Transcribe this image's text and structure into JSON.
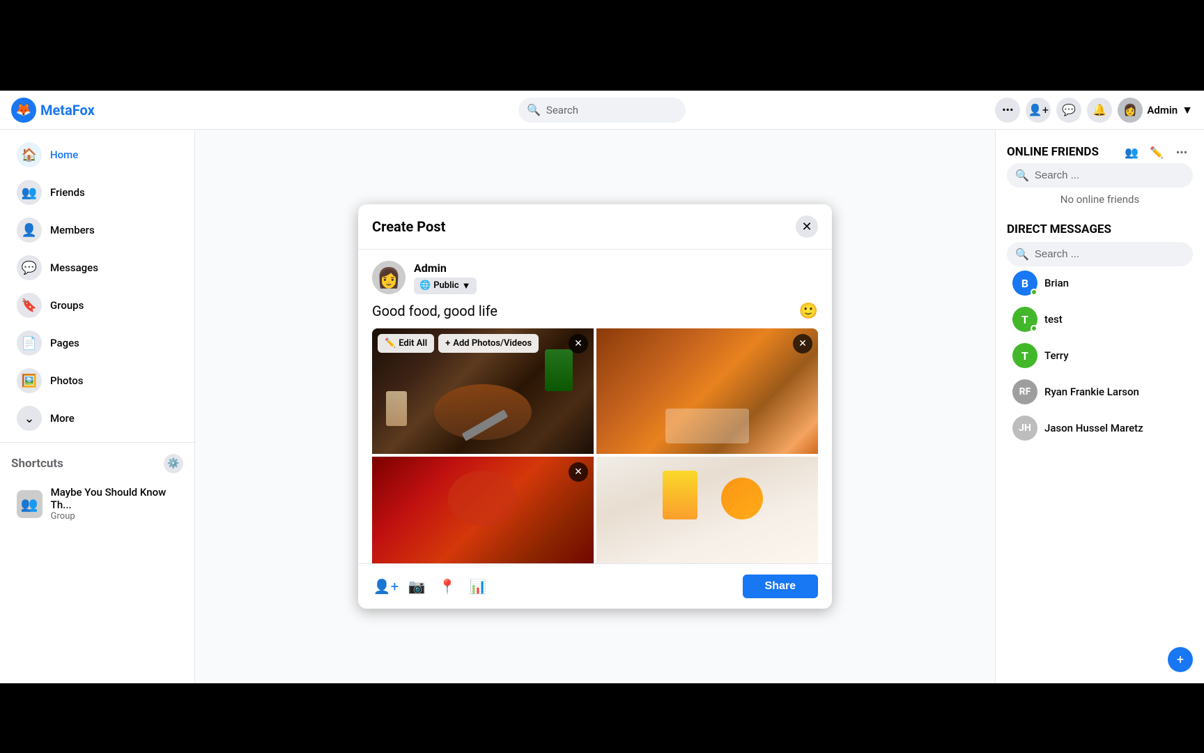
{
  "app": {
    "name": "MetaFox",
    "logo_char": "🦊"
  },
  "navbar": {
    "search_placeholder": "Search",
    "username": "Admin",
    "more_icon": "•••"
  },
  "sidebar": {
    "items": [
      {
        "label": "Home",
        "icon": "🏠",
        "active": true
      },
      {
        "label": "Friends",
        "icon": "👥",
        "active": false
      },
      {
        "label": "Members",
        "icon": "👤",
        "active": false
      },
      {
        "label": "Messages",
        "icon": "💬",
        "active": false
      },
      {
        "label": "Groups",
        "icon": "🔖",
        "active": false
      },
      {
        "label": "Pages",
        "icon": "📄",
        "active": false
      },
      {
        "label": "Photos",
        "icon": "🖼️",
        "active": false
      },
      {
        "label": "More",
        "icon": "⌄",
        "active": false
      }
    ],
    "shortcuts_title": "Shortcuts",
    "shortcuts": [
      {
        "name": "Maybe You Should Know Th...",
        "type": "Group"
      }
    ]
  },
  "online_friends": {
    "title": "ONLINE FRIENDS",
    "search_placeholder": "Search ...",
    "no_friends_text": "No online friends"
  },
  "direct_messages": {
    "title": "DIRECT MESSAGES",
    "search_placeholder": "Search ...",
    "contacts": [
      {
        "name": "Brian",
        "avatar_char": "B",
        "color_class": "brian",
        "online": true
      },
      {
        "name": "test",
        "avatar_char": "T",
        "color_class": "test",
        "online": true
      },
      {
        "name": "Terry",
        "avatar_char": "T",
        "color_class": "terry",
        "online": false
      },
      {
        "name": "Ryan Frankie Larson",
        "avatar_char": "R",
        "color_class": "ryan",
        "online": false
      },
      {
        "name": "Jason Hussel Maretz",
        "avatar_char": "J",
        "color_class": "jason",
        "online": false
      }
    ]
  },
  "create_post_modal": {
    "title": "Create Post",
    "close_label": "✕",
    "user_name": "Admin",
    "privacy": "Public",
    "post_text": "Good food, good life",
    "edit_all_label": "Edit All",
    "add_photos_label": "Add Photos/Videos",
    "share_label": "Share",
    "photos": [
      {
        "id": 1,
        "desc": "Steak with mashed potatoes and broccoli on dark plate"
      },
      {
        "id": 2,
        "desc": "Spicy chicken with rice and green onions"
      },
      {
        "id": 3,
        "desc": "Thai red curry soup"
      },
      {
        "id": 4,
        "desc": "Orange juice and orange slices on marble"
      }
    ]
  }
}
